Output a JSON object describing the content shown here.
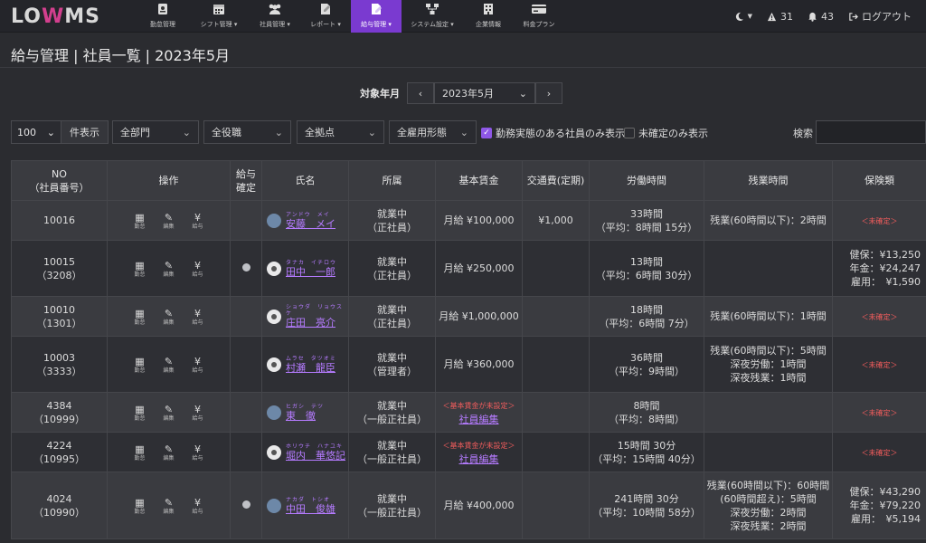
{
  "nav": {
    "logo_left": "LO",
    "logo_mid": "W",
    "logo_right": "MS",
    "items": [
      {
        "label": "勤怠管理",
        "icon": "badge-icon",
        "active": false
      },
      {
        "label": "シフト管理 ▾",
        "icon": "calendar-icon",
        "active": false
      },
      {
        "label": "社員管理 ▾",
        "icon": "users-icon",
        "active": false
      },
      {
        "label": "レポート ▾",
        "icon": "chart-icon",
        "active": false
      },
      {
        "label": "給与管理 ▾",
        "icon": "payroll-icon",
        "active": true
      },
      {
        "label": "システム設定 ▾",
        "icon": "sitemap-icon",
        "active": false
      },
      {
        "label": "企業情報",
        "icon": "building-icon",
        "active": false
      },
      {
        "label": "料金プラン",
        "icon": "card-icon",
        "active": false
      }
    ],
    "warning_count": "31",
    "bell_count": "43",
    "logout_label": "ログアウト"
  },
  "page": {
    "title": "給与管理 | 社員一覧 | 2023年5月"
  },
  "month": {
    "label": "対象年月",
    "value": "2023年5月"
  },
  "filters": {
    "count": "100",
    "count_suffix": "件表示",
    "dept": "全部門",
    "role": "全役職",
    "site": "全拠点",
    "employment": "全雇用形態",
    "chk1_label": "勤務実態のある社員のみ表示",
    "chk1_checked": true,
    "chk2_label": "未確定のみ表示",
    "chk2_checked": false,
    "search_label": "検索",
    "search_value": ""
  },
  "table": {
    "headers": {
      "no1": "NO",
      "no2": "（社員番号）",
      "ops": "操作",
      "confirm1": "給与",
      "confirm2": "確定",
      "name": "氏名",
      "dept": "所属",
      "base": "基本賃金",
      "commute": "交通費(定期)",
      "work": "労働時間",
      "overtime": "残業時間",
      "insurance": "保険類"
    },
    "op_labels": {
      "attendance": "勤怠",
      "edit": "編集",
      "pay": "給与"
    },
    "rows": [
      {
        "no": "10016",
        "emp": "",
        "confirmed": false,
        "kana": "アンドウ　メイ",
        "name": "安藤　メイ",
        "avatar": "photo",
        "status": "就業中",
        "type": "（正社員）",
        "base": "月給 ¥100,000",
        "base_unset": false,
        "commute": "¥1,000",
        "work": "33時間",
        "work_avg": "（平均：8時間 15分）",
        "overtime": [
          "残業(60時間以下)：2時間"
        ],
        "insurance": [],
        "insurance_unset": "＜未確定＞"
      },
      {
        "no": "10015",
        "emp": "（3208）",
        "confirmed": true,
        "kana": "タナカ　イチロウ",
        "name": "田中　一郎",
        "avatar": "default",
        "status": "就業中",
        "type": "（正社員）",
        "base": "月給 ¥250,000",
        "base_unset": false,
        "commute": "",
        "work": "13時間",
        "work_avg": "（平均：6時間 30分）",
        "overtime": [],
        "insurance": [
          "健保：¥13,250",
          "年金：¥24,247",
          "雇用：　¥1,590"
        ],
        "insurance_unset": ""
      },
      {
        "no": "10010",
        "emp": "（1301）",
        "confirmed": false,
        "kana": "ショウダ　リョウスケ",
        "name": "庄田　亮介",
        "avatar": "default",
        "status": "就業中",
        "type": "（正社員）",
        "base": "月給 ¥1,000,000",
        "base_unset": false,
        "commute": "",
        "work": "18時間",
        "work_avg": "（平均：6時間 7分）",
        "overtime": [
          "残業(60時間以下)：1時間"
        ],
        "insurance": [],
        "insurance_unset": "＜未確定＞"
      },
      {
        "no": "10003",
        "emp": "（3333）",
        "confirmed": false,
        "kana": "ムラセ　タツオミ",
        "name": "村瀬　龍臣",
        "avatar": "default",
        "status": "就業中",
        "type": "（管理者）",
        "base": "月給 ¥360,000",
        "base_unset": false,
        "commute": "",
        "work": "36時間",
        "work_avg": "（平均：9時間）",
        "overtime": [
          "残業(60時間以下)：5時間",
          "深夜労働：1時間",
          "深夜残業：1時間"
        ],
        "insurance": [],
        "insurance_unset": "＜未確定＞"
      },
      {
        "no": "4384",
        "emp": "（10999）",
        "confirmed": false,
        "kana": "ヒガシ　テツ",
        "name": "東　徹",
        "avatar": "photo",
        "status": "就業中",
        "type": "（一般正社員）",
        "base": "＜基本賃金が未設定＞",
        "base_unset": true,
        "base_link": "社員編集",
        "commute": "",
        "work": "8時間",
        "work_avg": "（平均：8時間）",
        "overtime": [],
        "insurance": [],
        "insurance_unset": "＜未確定＞"
      },
      {
        "no": "4224",
        "emp": "（10995）",
        "confirmed": false,
        "kana": "ホリウチ　ハナユキ",
        "name": "堀内　華悠記",
        "avatar": "default",
        "status": "就業中",
        "type": "（一般正社員）",
        "base": "＜基本賃金が未設定＞",
        "base_unset": true,
        "base_link": "社員編集",
        "commute": "",
        "work": "15時間 30分",
        "work_avg": "（平均：15時間 40分）",
        "overtime": [],
        "insurance": [],
        "insurance_unset": "＜未確定＞"
      },
      {
        "no": "4024",
        "emp": "（10990）",
        "confirmed": true,
        "kana": "ナカダ　トシオ",
        "name": "中田　俊雄",
        "avatar": "photo",
        "status": "就業中",
        "type": "（一般正社員）",
        "base": "月給 ¥400,000",
        "base_unset": false,
        "commute": "",
        "work": "241時間 30分",
        "work_avg": "（平均：10時間 58分）",
        "overtime": [
          "残業(60時間以下)：60時間",
          "(60時間超え)：5時間",
          "深夜労働：2時間",
          "深夜残業：2時間"
        ],
        "insurance": [
          "健保：¥43,290",
          "年金：¥79,220",
          "雇用：　¥5,194"
        ],
        "insurance_unset": ""
      }
    ]
  }
}
